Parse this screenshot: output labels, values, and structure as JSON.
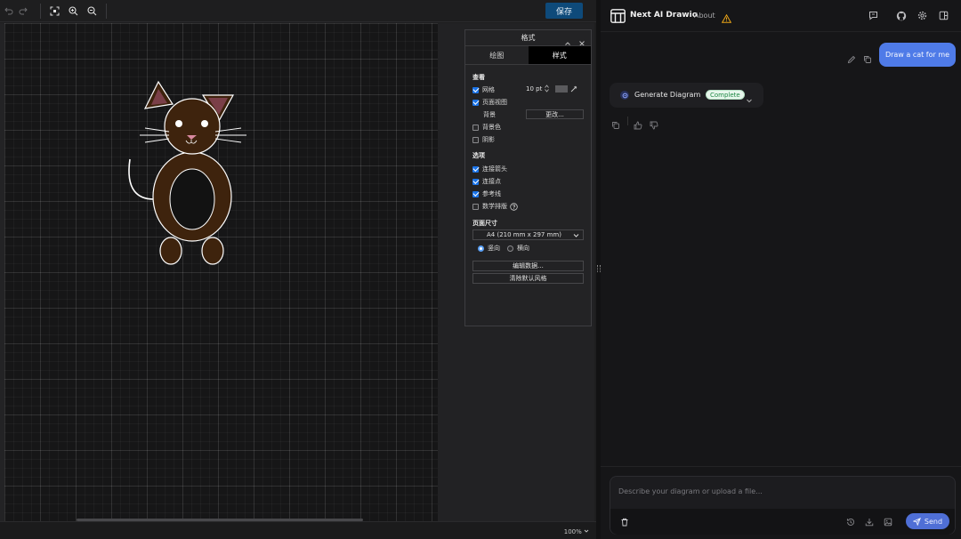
{
  "drawio": {
    "toolbar": {
      "save_label": "保存",
      "icons": [
        "undo-icon",
        "redo-icon",
        "fit-icon",
        "zoom-in-icon",
        "zoom-out-icon"
      ]
    },
    "zoom_level": "100%",
    "format_panel": {
      "title": "格式",
      "tabs": [
        "绘图",
        "样式"
      ],
      "active_tab": "样式",
      "view_section": "查看",
      "grid_label": "网格",
      "grid_checked": true,
      "grid_size": "10 pt",
      "page_view_label": "页面视图",
      "page_view_checked": true,
      "background_label": "背景",
      "background_change_button": "更改...",
      "background_color_label": "背景色",
      "background_color_checked": false,
      "shadow_label": "阴影",
      "shadow_checked": false,
      "options_section": "选项",
      "connection_arrows_label": "连接箭头",
      "connection_arrows_checked": true,
      "connection_points_label": "连接点",
      "connection_points_checked": true,
      "guides_label": "参考线",
      "guides_checked": true,
      "math_label": "数学排版",
      "math_checked": false,
      "page_size_section": "页面尺寸",
      "page_size_value": "A4 (210 mm x 297 mm)",
      "portrait_label": "竖向",
      "landscape_label": "横向",
      "orientation": "portrait",
      "edit_data_button": "编辑数据...",
      "clear_style_button": "清除默认风格"
    },
    "colors": {
      "cat_body": "#3e230d",
      "cat_belly": "#121212",
      "cat_outline": "#ffffff",
      "ear_inner": "#7a3f48",
      "nose": "#d98aa0"
    }
  },
  "chat": {
    "app_title": "Next AI Drawio",
    "about_link": "About",
    "header_icons": [
      "chat-icon",
      "github-icon",
      "settings-icon",
      "layout-icon"
    ],
    "user_message": "Draw a cat for me",
    "tool_call_label": "Generate Diagram",
    "tool_call_status": "Complete",
    "input_placeholder": "Describe your diagram or upload a file...",
    "send_label": "Send",
    "colors": {
      "user_bubble": "#4f7be8",
      "send_button": "#4f6fd6",
      "status_badge": "#e7f6ec",
      "warning": "#e8a317"
    }
  }
}
